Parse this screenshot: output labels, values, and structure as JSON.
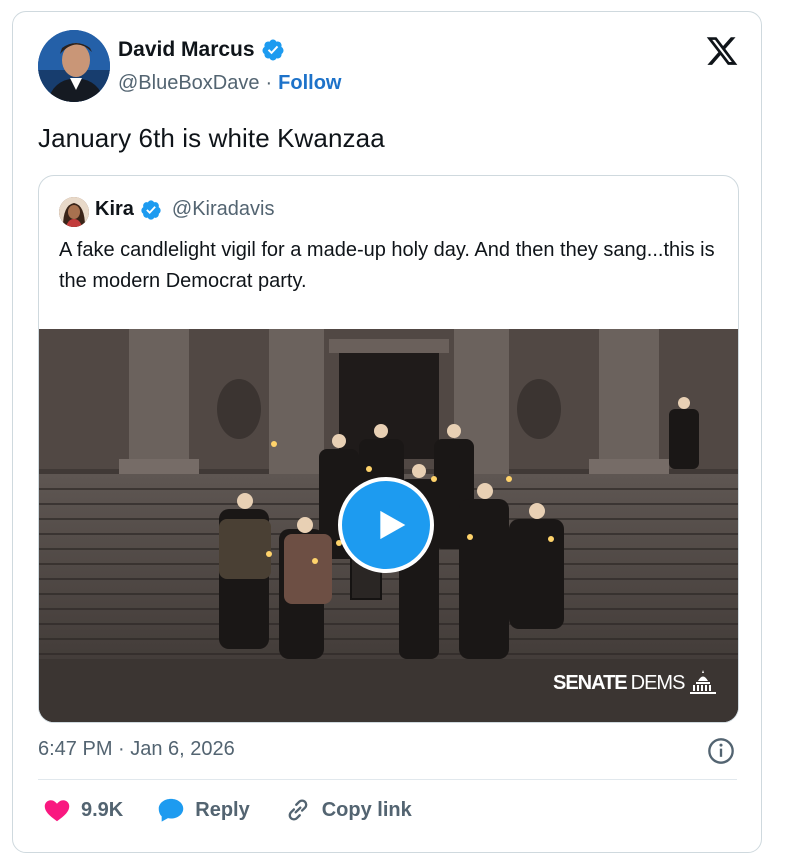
{
  "author": {
    "name": "David Marcus",
    "handle": "@BlueBoxDave",
    "separator": "·",
    "follow_label": "Follow"
  },
  "tweet": {
    "text": "January 6th is white Kwanzaa"
  },
  "quoted": {
    "name": "Kira",
    "handle": "@Kiradavis",
    "text": "A fake candlelight vigil for a made-up holy day. And then they sang...this is the modern Democrat party.",
    "video": {
      "watermark_senate": "SENATE",
      "watermark_dems": "DEMS"
    }
  },
  "meta": {
    "timestamp": "6:47 PM · Jan 6, 2026"
  },
  "actions": {
    "like_count": "9.9K",
    "reply_label": "Reply",
    "copy_link_label": "Copy link"
  },
  "colors": {
    "like": "#f91880",
    "reply": "#1d9bf0",
    "link": "#1d72c9",
    "verified": "#1d9bf0"
  },
  "icons": [
    "x-logo-icon",
    "verified-badge-icon",
    "play-icon",
    "info-icon",
    "heart-icon",
    "reply-bubble-icon",
    "link-icon",
    "capitol-icon"
  ]
}
